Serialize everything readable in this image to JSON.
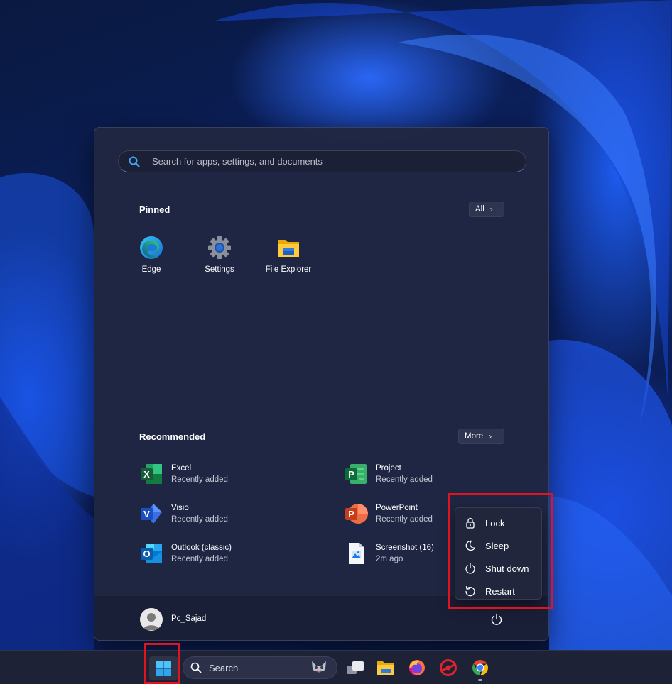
{
  "start_menu": {
    "search": {
      "placeholder": "Search for apps, settings, and documents"
    },
    "pinned": {
      "title": "Pinned",
      "all_button": "All",
      "apps": [
        {
          "label": "Edge",
          "icon": "edge-icon"
        },
        {
          "label": "Settings",
          "icon": "settings-gear-icon"
        },
        {
          "label": "File Explorer",
          "icon": "folder-icon"
        }
      ]
    },
    "recommended": {
      "title": "Recommended",
      "more_button": "More",
      "items": [
        {
          "name": "Excel",
          "subtitle": "Recently added",
          "icon": "excel-icon"
        },
        {
          "name": "Project",
          "subtitle": "Recently added",
          "icon": "project-icon"
        },
        {
          "name": "Visio",
          "subtitle": "Recently added",
          "icon": "visio-icon"
        },
        {
          "name": "PowerPoint",
          "subtitle": "Recently added",
          "icon": "powerpoint-icon"
        },
        {
          "name": "Outlook (classic)",
          "subtitle": "Recently added",
          "icon": "outlook-icon"
        },
        {
          "name": "Screenshot (16)",
          "subtitle": "2m ago",
          "icon": "image-file-icon"
        }
      ]
    },
    "user": {
      "name": "Pc_Sajad"
    }
  },
  "power_menu": {
    "items": [
      {
        "label": "Lock",
        "icon": "lock-icon"
      },
      {
        "label": "Sleep",
        "icon": "moon-icon"
      },
      {
        "label": "Shut down",
        "icon": "power-icon"
      },
      {
        "label": "Restart",
        "icon": "restart-icon"
      }
    ]
  },
  "taskbar": {
    "search_label": "Search",
    "apps": [
      "start-icon",
      "task-view-icon",
      "file-explorer-icon",
      "firefox-icon",
      "app-icon",
      "chrome-icon"
    ]
  },
  "colors": {
    "highlight": "#e0141e",
    "accent": "#3a8ee6"
  }
}
